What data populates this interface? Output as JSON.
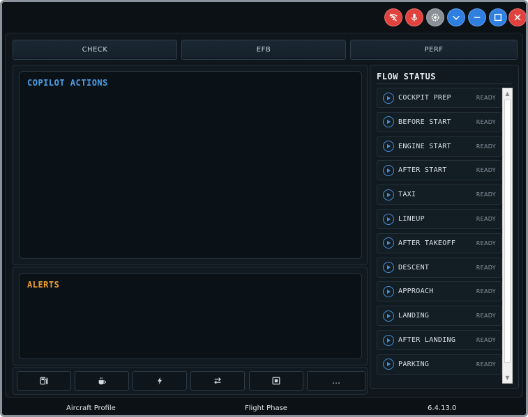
{
  "window_controls": [
    {
      "name": "wifi-off-icon",
      "color": "#e2423d"
    },
    {
      "name": "microphone-icon",
      "color": "#e2423d"
    },
    {
      "name": "settings-icon",
      "color": "#8a9096"
    },
    {
      "name": "chevron-down-icon",
      "color": "#2f7fe0"
    },
    {
      "name": "minimize-icon",
      "color": "#2f7fe0"
    },
    {
      "name": "maximize-icon",
      "color": "#2f7fe0"
    },
    {
      "name": "close-icon",
      "color": "#e2423d"
    }
  ],
  "tabs": [
    {
      "label": "CHECK"
    },
    {
      "label": "EFB"
    },
    {
      "label": "PERF"
    }
  ],
  "copilot": {
    "title": "COPILOT ACTIONS",
    "color": "#4a9fe8"
  },
  "alerts": {
    "title": "ALERTS",
    "color": "#f0a030"
  },
  "toolbar": [
    {
      "name": "fuel-icon"
    },
    {
      "name": "coffee-icon"
    },
    {
      "name": "lightning-icon"
    },
    {
      "name": "swap-icon"
    },
    {
      "name": "stop-icon"
    },
    {
      "name": "more-icon",
      "label": "…"
    }
  ],
  "flow_status": {
    "title": "FLOW STATUS",
    "items": [
      {
        "name": "COCKPIT PREP",
        "status": "READY"
      },
      {
        "name": "BEFORE START",
        "status": "READY"
      },
      {
        "name": "ENGINE START",
        "status": "READY"
      },
      {
        "name": "AFTER START",
        "status": "READY"
      },
      {
        "name": "TAXI",
        "status": "READY"
      },
      {
        "name": "LINEUP",
        "status": "READY"
      },
      {
        "name": "AFTER TAKEOFF",
        "status": "READY"
      },
      {
        "name": "DESCENT",
        "status": "READY"
      },
      {
        "name": "APPROACH",
        "status": "READY"
      },
      {
        "name": "LANDING",
        "status": "READY"
      },
      {
        "name": "AFTER LANDING",
        "status": "READY"
      },
      {
        "name": "PARKING",
        "status": "READY"
      }
    ]
  },
  "statusbar": {
    "aircraft_profile": "Aircraft Profile",
    "flight_phase": "Flight Phase",
    "version": "6.4.13.0"
  }
}
